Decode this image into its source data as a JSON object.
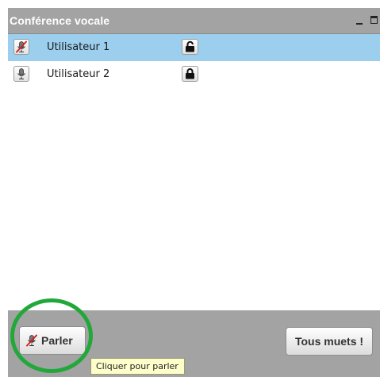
{
  "window": {
    "title": "Conférence vocale"
  },
  "users": [
    {
      "name": "Utilisateur 1",
      "mic_state": "muted",
      "lock_state": "unlocked",
      "selected": true
    },
    {
      "name": "Utilisateur 2",
      "mic_state": "active",
      "lock_state": "locked",
      "selected": false
    }
  ],
  "footer": {
    "talk_label": "Parler",
    "mute_all_label": "Tous muets !",
    "talk_tooltip": "Cliquer pour parler"
  },
  "colors": {
    "panel": "#a3a3a3",
    "selected_row": "#9ccfee",
    "highlight_circle": "#22a83a",
    "tooltip_bg": "#ffffcc",
    "mute_slash": "#d42020"
  },
  "icons": {
    "muted_mic": "muted-mic-icon",
    "mic": "microphone-icon",
    "lock_open": "unlocked-icon",
    "lock_closed": "locked-icon"
  }
}
